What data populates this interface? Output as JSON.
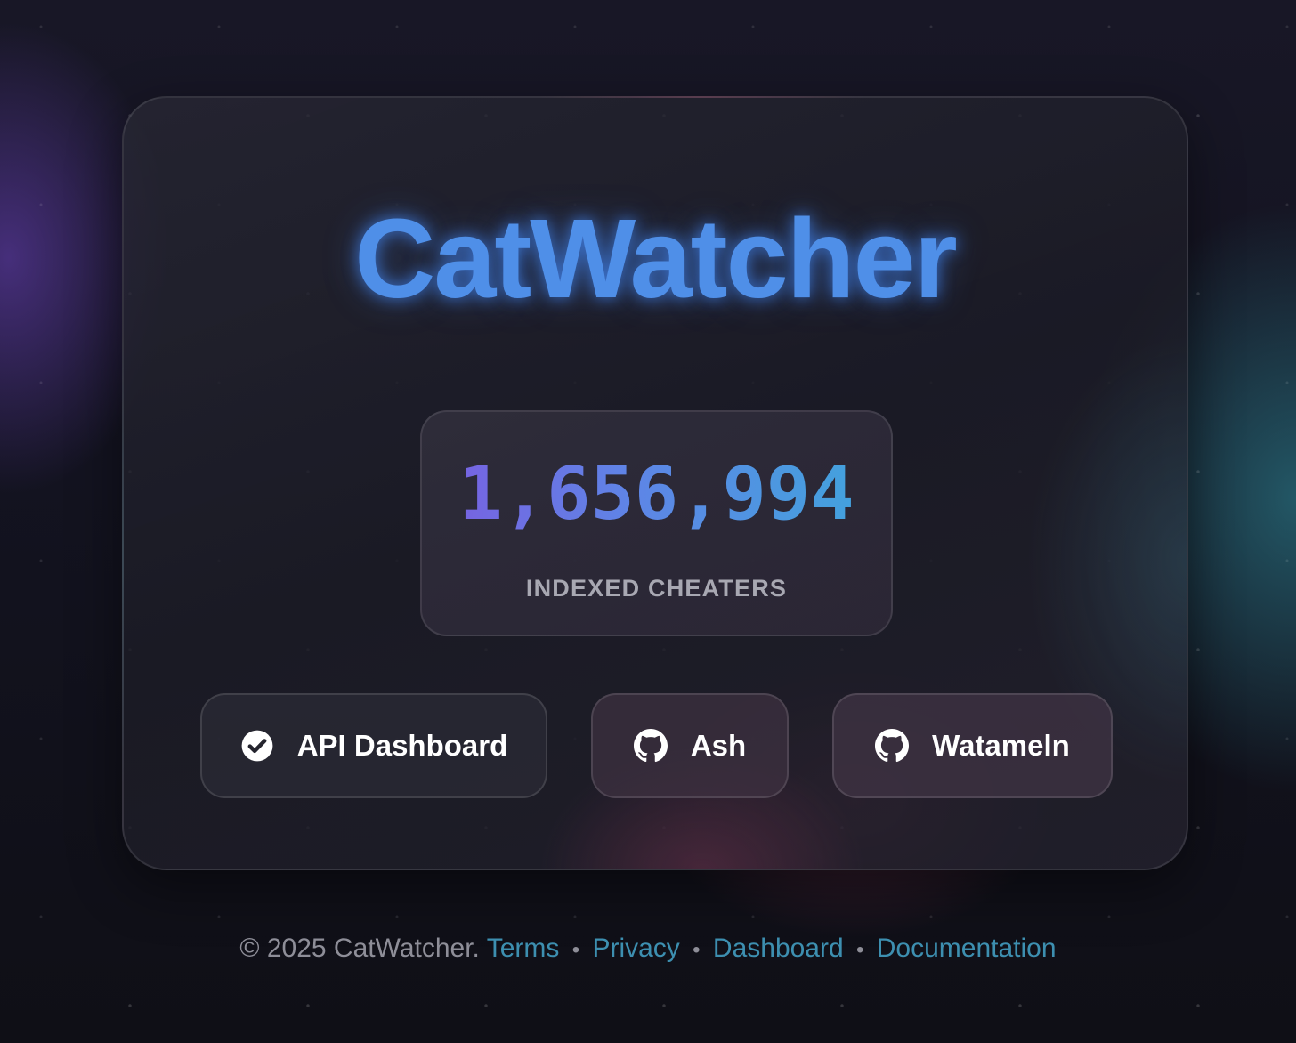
{
  "app": {
    "title": "CatWatcher"
  },
  "stats": {
    "count": "1,656,994",
    "label": "INDEXED CHEATERS"
  },
  "buttons": [
    {
      "label": "API Dashboard",
      "icon": "check-circle-icon"
    },
    {
      "label": "Ash",
      "icon": "github-icon"
    },
    {
      "label": "Watameln",
      "icon": "github-icon"
    }
  ],
  "footer": {
    "copyright": "© 2025 CatWatcher.",
    "separator": "•",
    "links": [
      "Terms",
      "Privacy",
      "Dashboard",
      "Documentation"
    ]
  },
  "colors": {
    "title": "#4f8fe8",
    "link": "#3d8fb0",
    "number_gradient_start": "#7b5de0",
    "number_gradient_end": "#3fa6dc"
  }
}
